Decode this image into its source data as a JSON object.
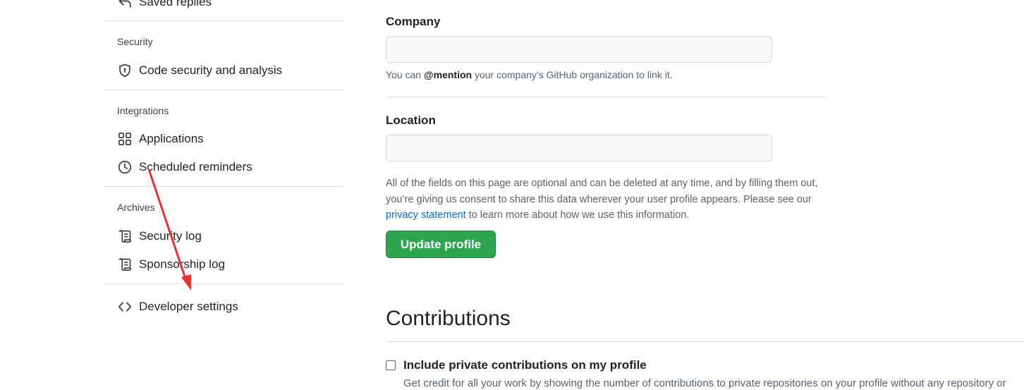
{
  "sidebar": {
    "top_item": {
      "label": "Saved replies",
      "icon": "reply-icon"
    },
    "sections": [
      {
        "heading": "Security",
        "items": [
          {
            "label": "Code security and analysis",
            "icon": "shield-icon"
          }
        ]
      },
      {
        "heading": "Integrations",
        "items": [
          {
            "label": "Applications",
            "icon": "apps-grid-icon"
          },
          {
            "label": "Scheduled reminders",
            "icon": "clock-icon"
          }
        ]
      },
      {
        "heading": "Archives",
        "items": [
          {
            "label": "Security log",
            "icon": "log-icon"
          },
          {
            "label": "Sponsorship log",
            "icon": "log-icon"
          }
        ]
      }
    ],
    "developer": {
      "label": "Developer settings",
      "icon": "code-icon"
    }
  },
  "form": {
    "company": {
      "label": "Company",
      "value": "",
      "placeholder": "",
      "hint_prefix": "You can ",
      "hint_mention": "@mention",
      "hint_suffix": " your company’s GitHub organization to link it."
    },
    "location": {
      "label": "Location",
      "value": "",
      "placeholder": ""
    },
    "disclaimer": {
      "text_before": "All of the fields on this page are optional and can be deleted at any time, and by filling them out, you’re giving us consent to share this data wherever your user profile appears. Please see our ",
      "link_text": "privacy statement",
      "text_after": " to learn more about how we use this information."
    },
    "submit_label": "Update profile"
  },
  "contributions": {
    "heading": "Contributions",
    "checkbox_label": "Include private contributions on my profile",
    "checkbox_checked": false,
    "description": "Get credit for all your work by showing the number of contributions to private repositories on your profile without any repository or"
  },
  "colors": {
    "accent_green": "#2da44e",
    "link_blue": "#0969da",
    "annotation_red": "#e8332d"
  }
}
